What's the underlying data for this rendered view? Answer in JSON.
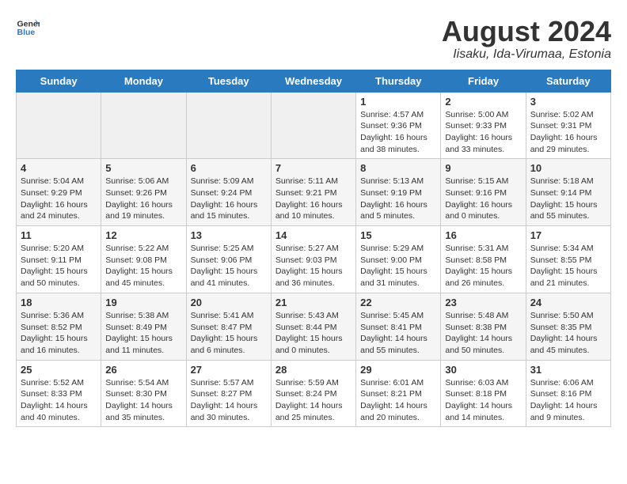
{
  "header": {
    "logo_general": "General",
    "logo_blue": "Blue",
    "title": "August 2024",
    "location": "Iisaku, Ida-Virumaa, Estonia"
  },
  "weekdays": [
    "Sunday",
    "Monday",
    "Tuesday",
    "Wednesday",
    "Thursday",
    "Friday",
    "Saturday"
  ],
  "weeks": [
    [
      {
        "day": "",
        "info": ""
      },
      {
        "day": "",
        "info": ""
      },
      {
        "day": "",
        "info": ""
      },
      {
        "day": "",
        "info": ""
      },
      {
        "day": "1",
        "info": "Sunrise: 4:57 AM\nSunset: 9:36 PM\nDaylight: 16 hours\nand 38 minutes."
      },
      {
        "day": "2",
        "info": "Sunrise: 5:00 AM\nSunset: 9:33 PM\nDaylight: 16 hours\nand 33 minutes."
      },
      {
        "day": "3",
        "info": "Sunrise: 5:02 AM\nSunset: 9:31 PM\nDaylight: 16 hours\nand 29 minutes."
      }
    ],
    [
      {
        "day": "4",
        "info": "Sunrise: 5:04 AM\nSunset: 9:29 PM\nDaylight: 16 hours\nand 24 minutes."
      },
      {
        "day": "5",
        "info": "Sunrise: 5:06 AM\nSunset: 9:26 PM\nDaylight: 16 hours\nand 19 minutes."
      },
      {
        "day": "6",
        "info": "Sunrise: 5:09 AM\nSunset: 9:24 PM\nDaylight: 16 hours\nand 15 minutes."
      },
      {
        "day": "7",
        "info": "Sunrise: 5:11 AM\nSunset: 9:21 PM\nDaylight: 16 hours\nand 10 minutes."
      },
      {
        "day": "8",
        "info": "Sunrise: 5:13 AM\nSunset: 9:19 PM\nDaylight: 16 hours\nand 5 minutes."
      },
      {
        "day": "9",
        "info": "Sunrise: 5:15 AM\nSunset: 9:16 PM\nDaylight: 16 hours\nand 0 minutes."
      },
      {
        "day": "10",
        "info": "Sunrise: 5:18 AM\nSunset: 9:14 PM\nDaylight: 15 hours\nand 55 minutes."
      }
    ],
    [
      {
        "day": "11",
        "info": "Sunrise: 5:20 AM\nSunset: 9:11 PM\nDaylight: 15 hours\nand 50 minutes."
      },
      {
        "day": "12",
        "info": "Sunrise: 5:22 AM\nSunset: 9:08 PM\nDaylight: 15 hours\nand 45 minutes."
      },
      {
        "day": "13",
        "info": "Sunrise: 5:25 AM\nSunset: 9:06 PM\nDaylight: 15 hours\nand 41 minutes."
      },
      {
        "day": "14",
        "info": "Sunrise: 5:27 AM\nSunset: 9:03 PM\nDaylight: 15 hours\nand 36 minutes."
      },
      {
        "day": "15",
        "info": "Sunrise: 5:29 AM\nSunset: 9:00 PM\nDaylight: 15 hours\nand 31 minutes."
      },
      {
        "day": "16",
        "info": "Sunrise: 5:31 AM\nSunset: 8:58 PM\nDaylight: 15 hours\nand 26 minutes."
      },
      {
        "day": "17",
        "info": "Sunrise: 5:34 AM\nSunset: 8:55 PM\nDaylight: 15 hours\nand 21 minutes."
      }
    ],
    [
      {
        "day": "18",
        "info": "Sunrise: 5:36 AM\nSunset: 8:52 PM\nDaylight: 15 hours\nand 16 minutes."
      },
      {
        "day": "19",
        "info": "Sunrise: 5:38 AM\nSunset: 8:49 PM\nDaylight: 15 hours\nand 11 minutes."
      },
      {
        "day": "20",
        "info": "Sunrise: 5:41 AM\nSunset: 8:47 PM\nDaylight: 15 hours\nand 6 minutes."
      },
      {
        "day": "21",
        "info": "Sunrise: 5:43 AM\nSunset: 8:44 PM\nDaylight: 15 hours\nand 0 minutes."
      },
      {
        "day": "22",
        "info": "Sunrise: 5:45 AM\nSunset: 8:41 PM\nDaylight: 14 hours\nand 55 minutes."
      },
      {
        "day": "23",
        "info": "Sunrise: 5:48 AM\nSunset: 8:38 PM\nDaylight: 14 hours\nand 50 minutes."
      },
      {
        "day": "24",
        "info": "Sunrise: 5:50 AM\nSunset: 8:35 PM\nDaylight: 14 hours\nand 45 minutes."
      }
    ],
    [
      {
        "day": "25",
        "info": "Sunrise: 5:52 AM\nSunset: 8:33 PM\nDaylight: 14 hours\nand 40 minutes."
      },
      {
        "day": "26",
        "info": "Sunrise: 5:54 AM\nSunset: 8:30 PM\nDaylight: 14 hours\nand 35 minutes."
      },
      {
        "day": "27",
        "info": "Sunrise: 5:57 AM\nSunset: 8:27 PM\nDaylight: 14 hours\nand 30 minutes."
      },
      {
        "day": "28",
        "info": "Sunrise: 5:59 AM\nSunset: 8:24 PM\nDaylight: 14 hours\nand 25 minutes."
      },
      {
        "day": "29",
        "info": "Sunrise: 6:01 AM\nSunset: 8:21 PM\nDaylight: 14 hours\nand 20 minutes."
      },
      {
        "day": "30",
        "info": "Sunrise: 6:03 AM\nSunset: 8:18 PM\nDaylight: 14 hours\nand 14 minutes."
      },
      {
        "day": "31",
        "info": "Sunrise: 6:06 AM\nSunset: 8:16 PM\nDaylight: 14 hours\nand 9 minutes."
      }
    ]
  ]
}
